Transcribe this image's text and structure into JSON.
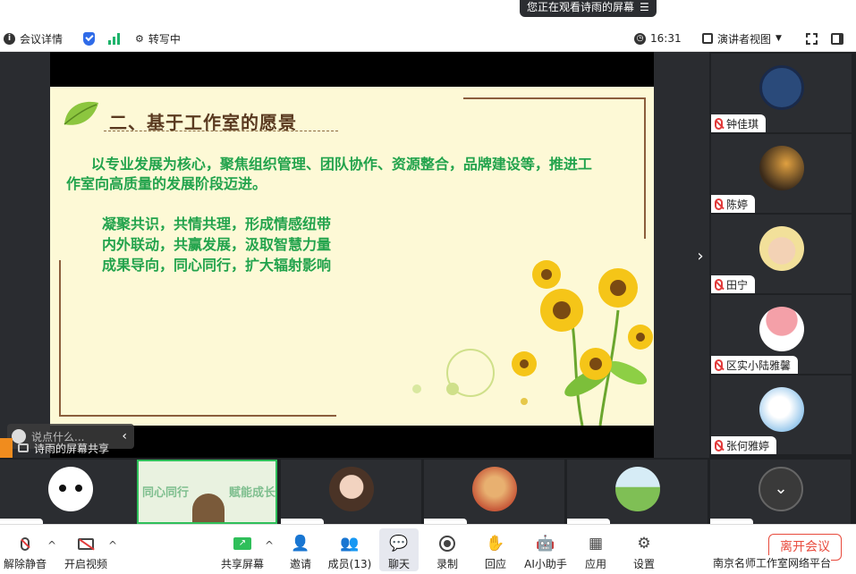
{
  "banner": {
    "text": "您正在观看诗雨的屏幕",
    "icon": "menu-icon"
  },
  "toolbar": {
    "meeting_info": "会议详情",
    "transcribe": "转写中",
    "time": "16:31",
    "presenter_view": "演讲者视图"
  },
  "slide": {
    "title": "二、基于工作室的愿景",
    "paragraph": "以专业发展为核心，聚焦组织管理、团队协作、资源整合，品牌建设等，推进工作室向高质量的发展阶段迈进。",
    "lines": [
      "凝聚共识，共情共理，形成情感纽带",
      "内外联动，共赢发展，汲取智慧力量",
      "成果导向，同心同行，扩大辐射影响"
    ],
    "colors": {
      "title": "#5a3a20",
      "text": "#22a34c",
      "background": "#fdf9d6"
    }
  },
  "stage": {
    "chat_placeholder": "说点什么...",
    "share_label": "诗雨的屏幕共享"
  },
  "participants_right": [
    {
      "name": "钟佳琪",
      "avatar": "avatar-zhong"
    },
    {
      "name": "陈婷",
      "avatar": "avatar-chen"
    },
    {
      "name": "田宁",
      "avatar": "avatar-tian"
    },
    {
      "name": "区实小陆雅馨",
      "avatar": "avatar-lu"
    },
    {
      "name": "张何雅婷",
      "avatar": "avatar-zhang"
    }
  ],
  "participants_bottom": {
    "video_text_left": "同心同行",
    "video_text_right": "赋能成长"
  },
  "controls": {
    "unmute": "解除静音",
    "start_video": "开启视频",
    "share_screen": "共享屏幕",
    "invite": "邀请",
    "members": "成员(13)",
    "chat": "聊天",
    "record": "录制",
    "reactions": "回应",
    "ai_assistant": "AI小助手",
    "apps": "应用",
    "settings": "设置",
    "leave": "离开会议",
    "footer": "南京名师工作室网络平台"
  },
  "accent": {
    "leave": "#e84a3c",
    "brand": "#2f6be8",
    "signal": "#1db36b",
    "muted": "#e23b3b"
  }
}
